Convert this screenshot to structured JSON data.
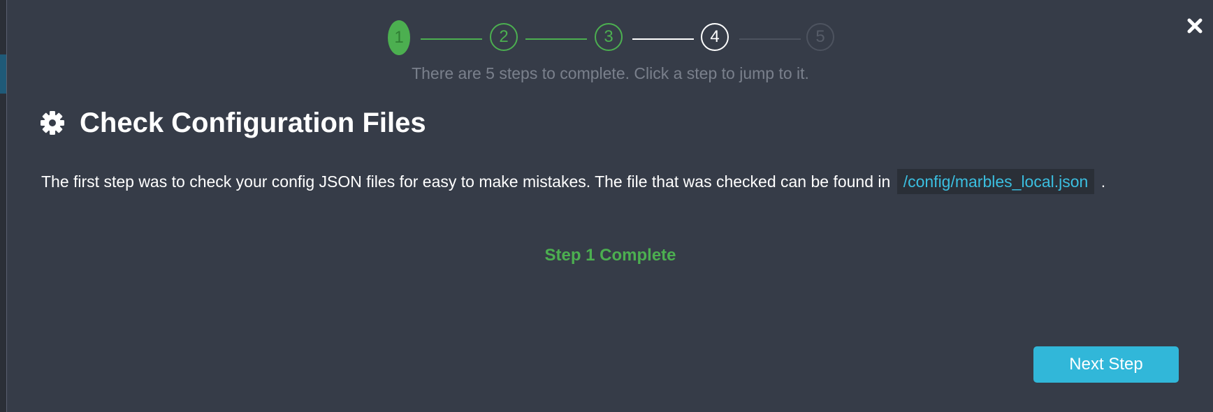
{
  "stepper": {
    "steps": [
      {
        "label": "1",
        "state": "done"
      },
      {
        "label": "2",
        "state": "done"
      },
      {
        "label": "3",
        "state": "done"
      },
      {
        "label": "4",
        "state": "current"
      },
      {
        "label": "5",
        "state": "future"
      }
    ],
    "hint": "There are 5 steps to complete. Click a step to jump to it."
  },
  "header": {
    "title": "Check Configuration Files",
    "icon": "gear-icon"
  },
  "body": {
    "description_before": "The first step was to check your config JSON files for easy to make mistakes. The file that was checked can be found in",
    "config_path": "/config/marbles_local.json",
    "description_after": "."
  },
  "status": {
    "text": "Step 1 Complete",
    "color": "#4caf50"
  },
  "actions": {
    "next_label": "Next Step"
  },
  "close": {
    "icon": "close-icon"
  },
  "colors": {
    "modal_bg": "#363c48",
    "accent_green": "#4caf50",
    "accent_blue": "#31b7d9",
    "link_blue": "#3bbfe0"
  }
}
